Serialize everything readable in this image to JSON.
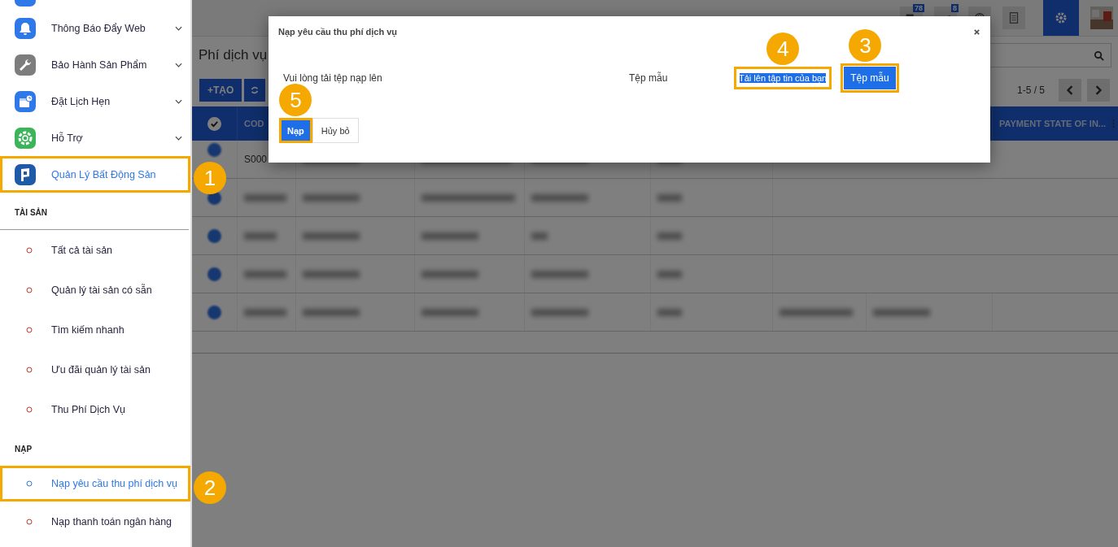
{
  "sidebar": {
    "menu": [
      {
        "label": "Thông Báo Đẩy Web",
        "expanded": false,
        "selected": false
      },
      {
        "label": "Bảo Hành Sản Phẩm",
        "expanded": false,
        "selected": false
      },
      {
        "label": "Đặt Lịch Hẹn",
        "expanded": false,
        "selected": false
      },
      {
        "label": "Hỗ Trợ",
        "expanded": false,
        "selected": false
      },
      {
        "label": "Quản Lý Bất Động Sản",
        "expanded": true,
        "selected": true,
        "marker": "1"
      }
    ],
    "sections": [
      {
        "title": "TÀI SẢN",
        "items": [
          {
            "label": "Tất cả tài sản",
            "selected": false
          },
          {
            "label": "Quản lý tài sản có sẵn",
            "selected": false
          },
          {
            "label": "Tìm kiếm nhanh",
            "selected": false
          },
          {
            "label": "Ưu đãi quản lý tài sản",
            "selected": false
          },
          {
            "label": "Thu Phí Dịch Vụ",
            "selected": false
          }
        ]
      },
      {
        "title": "NẠP",
        "items": [
          {
            "label": "Nạp yêu cầu thu phí dịch vụ",
            "selected": true,
            "marker": "2"
          },
          {
            "label": "Nạp thanh toán ngân hàng",
            "selected": false
          }
        ]
      }
    ]
  },
  "topbar": {
    "badges": [
      "78",
      "8"
    ]
  },
  "page": {
    "title": "Phí dịch vụ",
    "create_button": "+TẠO",
    "pager": "1-5 / 5"
  },
  "table": {
    "columns": [
      "COD",
      "PAYMENT STATE OF IN..."
    ],
    "all_checked": true,
    "rows": [
      {
        "kind": "visible",
        "code": "S000",
        "checked": true
      },
      {
        "kind": "redacted",
        "checked": true
      },
      {
        "kind": "redacted",
        "checked": true
      },
      {
        "kind": "redacted",
        "checked": true
      },
      {
        "kind": "redacted",
        "checked": true
      }
    ]
  },
  "dialog": {
    "title": "Nạp yêu cầu thu phí dịch vụ",
    "prompt": "Vui lòng tải tệp nạp lên",
    "template_label": "Tệp mẫu",
    "upload": {
      "label": "Tải lên tập tin của bạn",
      "marker": "4"
    },
    "template_button": {
      "label": "Tệp mẫu",
      "marker": "3"
    },
    "buttons": [
      {
        "label": "Nạp",
        "primary": true,
        "marker": "5"
      },
      {
        "label": "Hủy bỏ",
        "primary": false
      }
    ]
  }
}
